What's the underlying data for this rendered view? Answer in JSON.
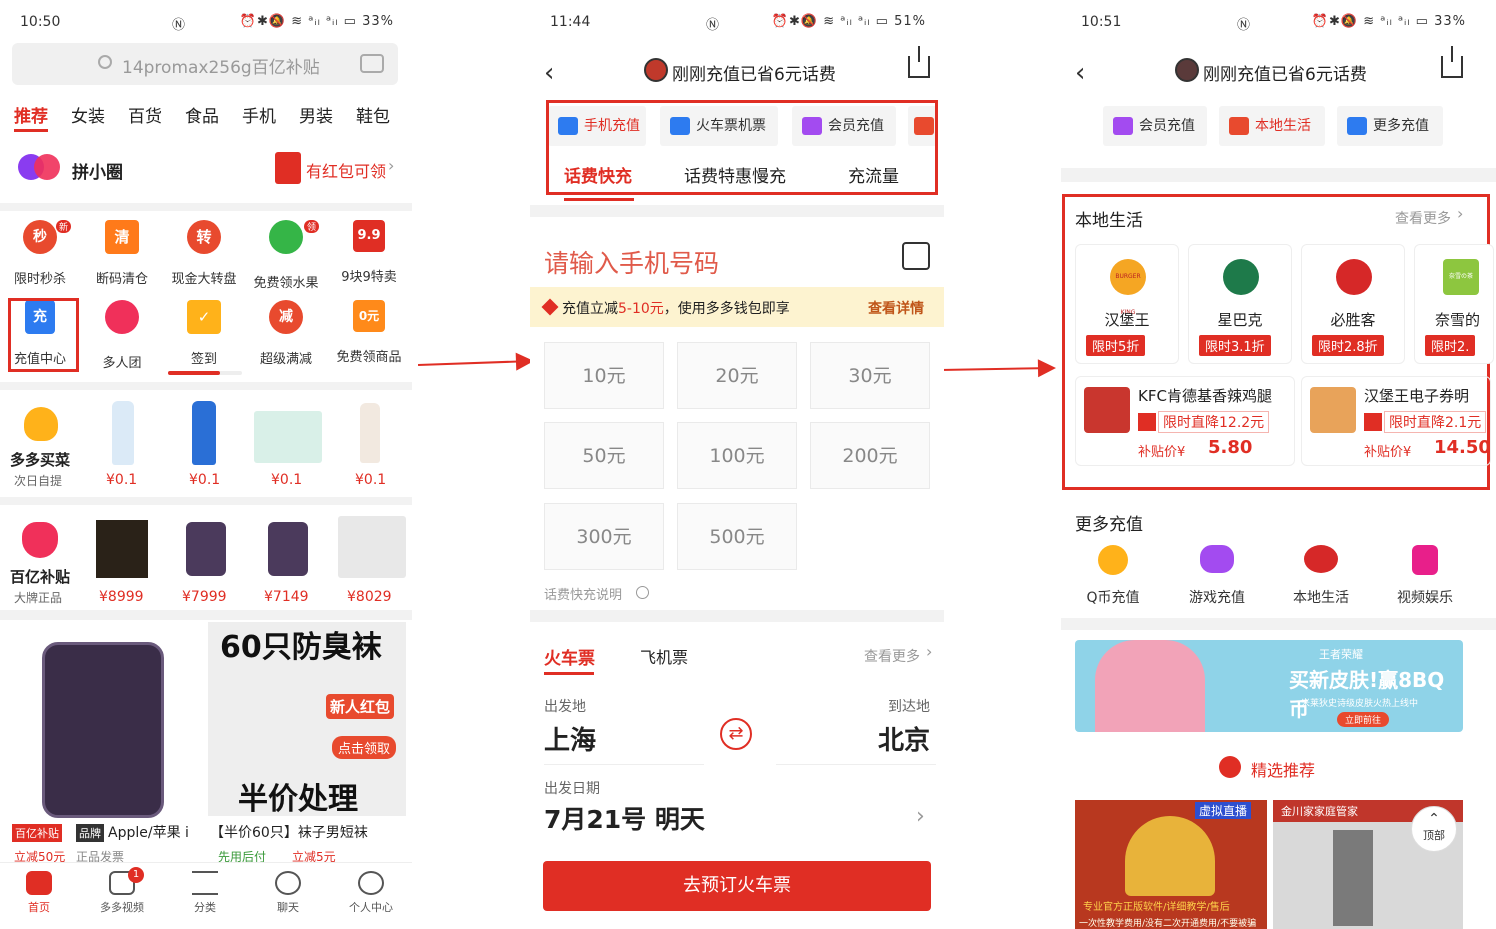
{
  "p1": {
    "time": "10:50",
    "battery": "33%",
    "search_placeholder": "14promax256g百亿补贴",
    "categories": [
      "推荐",
      "女装",
      "百货",
      "食品",
      "手机",
      "男装",
      "鞋包"
    ],
    "circle_label": "拼小圈",
    "redpack_label": "有红包可领",
    "row1": [
      {
        "label": "限时秒杀",
        "glyph": "秒",
        "badge": "新"
      },
      {
        "label": "断码清仓",
        "glyph": "清"
      },
      {
        "label": "现金大转盘",
        "glyph": "转"
      },
      {
        "label": "免费领水果",
        "glyph": "",
        "badge": "领"
      },
      {
        "label": "9块9特卖",
        "glyph": "9.9"
      }
    ],
    "row2": [
      {
        "label": "充值中心",
        "glyph": "充"
      },
      {
        "label": "多人团",
        "glyph": ""
      },
      {
        "label": "签到",
        "glyph": "✓"
      },
      {
        "label": "超级满减",
        "glyph": "减"
      },
      {
        "label": "免费领商品",
        "glyph": "0元"
      }
    ],
    "maicai": {
      "title": "多多买菜",
      "sub": "次日自提",
      "prices": [
        "¥0.1",
        "¥0.1",
        "¥0.1",
        "¥0.1"
      ]
    },
    "baiyi": {
      "title": "百亿补贴",
      "sub": "大牌正品",
      "prices": [
        "¥8999",
        "¥7999",
        "¥7149",
        "¥8029"
      ]
    },
    "feed": [
      {
        "badge1": "百亿补贴",
        "badge2": "品牌",
        "title": "Apple/苹果 i",
        "tag1": "立减50元",
        "tag2": "正品发票"
      },
      {
        "title": "【半价60只】袜子男短袜",
        "tag1": "先用后付",
        "tag2": "立减5元",
        "banner": "60只防臭袜",
        "promo1": "新人红包",
        "promo2": "点击领取",
        "banner2": "半价处理"
      }
    ],
    "nav": [
      {
        "label": "首页"
      },
      {
        "label": "多多视频",
        "badge": "1"
      },
      {
        "label": "分类"
      },
      {
        "label": "聊天"
      },
      {
        "label": "个人中心"
      }
    ]
  },
  "p2": {
    "time": "11:44",
    "battery": "51%",
    "title": "刚刚充值已省6元话费",
    "chips": [
      "手机充值",
      "火车票机票",
      "会员充值"
    ],
    "subtabs": [
      "话费快充",
      "话费特惠慢充",
      "充流量"
    ],
    "phone_prompt": "请输入手机号码",
    "promo_text": "充值立减",
    "promo_amount": "5-10元",
    "promo_suffix": "，使用多多钱包即享",
    "promo_link": "查看详情",
    "amounts": [
      "10元",
      "20元",
      "30元",
      "50元",
      "100元",
      "200元",
      "300元",
      "500元"
    ],
    "note": "话费快充说明",
    "ticket_tabs": [
      "火车票",
      "飞机票"
    ],
    "more": "查看更多",
    "from_label": "出发地",
    "from_city": "上海",
    "to_label": "到达地",
    "to_city": "北京",
    "date_label": "出发日期",
    "date_value": "7月21号 明天",
    "book_button": "去预订火车票"
  },
  "p3": {
    "time": "10:51",
    "battery": "33%",
    "title": "刚刚充值已省6元话费",
    "chips": [
      "会员充值",
      "本地生活",
      "更多充值"
    ],
    "local_title": "本地生活",
    "more": "查看更多",
    "shops": [
      {
        "name": "汉堡王",
        "deal": "限时5折",
        "logo_text": "BURGER KING"
      },
      {
        "name": "星巴克",
        "deal": "限时3.1折"
      },
      {
        "name": "必胜客",
        "deal": "限时2.8折"
      },
      {
        "name": "奈雪的",
        "deal": "限时2.",
        "logo_text": "奈雪の茶"
      }
    ],
    "products": [
      {
        "name": "KFC肯德基香辣鸡腿",
        "drop": "限时直降12.2元",
        "price_label": "补贴价¥",
        "price": "5.80"
      },
      {
        "name": "汉堡王电子券明",
        "drop": "限时直降2.1元",
        "price_label": "补贴价¥",
        "price": "14.50"
      }
    ],
    "more_recharge_title": "更多充值",
    "more_recharge": [
      "Q币充值",
      "游戏充值",
      "本地生活",
      "视频娱乐"
    ],
    "banner_text": "买新皮肤!赢8BQ币",
    "banner_brand": "王者荣耀",
    "banner_sub": "米莱狄史诗级皮肤火热上线中",
    "banner_btn": "立即前往",
    "featured": "精选推荐",
    "video1": "虚拟直播",
    "video1_sub": "专业官方正版软件/详细教学/售后",
    "video1_sub2": "一次性教学费用/没有二次开通费用/不要被骗",
    "video2": "金川家家庭管家",
    "top_btn": "顶部"
  },
  "colors": {
    "accent": "#e02e24",
    "promo_bg": "#fdf3d0"
  }
}
